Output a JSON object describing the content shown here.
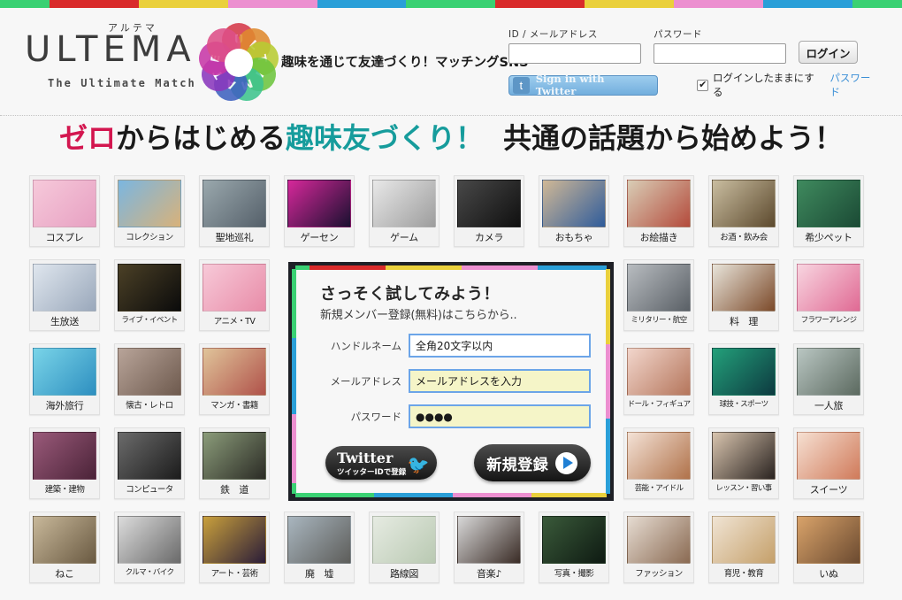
{
  "topbar_colors": [
    "#3ad173",
    "#d92b2b",
    "#ead03c",
    "#ec8fd0",
    "#2a9fd8"
  ],
  "header": {
    "logo_kana": "アルテマ",
    "logo_main": "ULTEMA",
    "logo_sub": "The Ultimate Match",
    "tagline": "趣味を通じて友達づくり！マッチングSNS",
    "flower_letters": [
      "U",
      "L",
      "T",
      "I",
      "M",
      "A",
      "T",
      "E"
    ],
    "flower_colors": [
      "#d6394a",
      "#e08a2f",
      "#b9cc33",
      "#6ec53f",
      "#3ec48e",
      "#3f62c0",
      "#8a38bd",
      "#c838a8",
      "#dd4f88"
    ]
  },
  "login": {
    "id_label": "ID / メールアドレス",
    "id_value": "",
    "id_placeholder": "",
    "password_label": "パスワード",
    "password_value": "",
    "password_placeholder": "",
    "login_button": "ログイン",
    "twitter_button": "Sign in with Twitter",
    "twitter_icon": "t",
    "keep_logged_in": "ログインしたままにする",
    "keep_checked": true,
    "password_link": "パスワード"
  },
  "headline": {
    "part1": "ゼロ",
    "part2": "からはじめる",
    "part3": "趣味友づくり！",
    "part4": "共通の話題から始めよう！",
    "color1": "#d3164f",
    "color3": "#169c9c"
  },
  "signup": {
    "title": "さっそく試してみよう！",
    "subtitle": "新規メンバー登録(無料)はこちらから..",
    "fields": [
      {
        "label": "ハンドルネーム",
        "value": "全角20文字以内",
        "style": "white"
      },
      {
        "label": "メールアドレス",
        "value": "メールアドレスを入力",
        "style": "yellow"
      },
      {
        "label": "パスワード",
        "value": "●●●●",
        "style": "yellow"
      }
    ],
    "twitter_main": "Twitter",
    "twitter_sub": "ツイッターIDで登録",
    "register_label": "新規登録",
    "border_top": [
      "#3ad173",
      "#d92b2b",
      "#ead03c",
      "#ec8fd0",
      "#2a9fd8"
    ],
    "border_bottom": [
      "#3ad173",
      "#2a9fd8",
      "#ec8fd0",
      "#ead03c"
    ],
    "border_left": [
      "#3ad173",
      "#2a9fd8",
      "#ec8fd0",
      "#3ad173"
    ],
    "border_right": [
      "#ead03c",
      "#ec8fd0",
      "#2a9fd8"
    ],
    "input_border": "#6ca5e8",
    "input_yellow_bg": "#f5f5c8"
  },
  "grid": {
    "rows": [
      [
        {
          "label": "コスプレ",
          "img": "cosplay",
          "c1": "#f6c9da",
          "c2": "#e7a0c2"
        },
        {
          "label": "コレクション",
          "img": "collection",
          "c1": "#7bb6e0",
          "c2": "#d8b27a",
          "size": "sq"
        },
        {
          "label": "聖地巡礼",
          "img": "pilgrimage",
          "c1": "#9aa8ad",
          "c2": "#55606a"
        },
        {
          "label": "ゲーセン",
          "img": "arcade",
          "c1": "#d6289a",
          "c2": "#1a1030"
        },
        {
          "label": "ゲーム",
          "img": "game",
          "c1": "#e8e8e8",
          "c2": "#9d9d9d"
        },
        {
          "label": "カメラ",
          "img": "camera",
          "c1": "#484848",
          "c2": "#101010"
        },
        {
          "label": "おもちゃ",
          "img": "toys",
          "c1": "#d0b896",
          "c2": "#2f5c9b"
        },
        {
          "label": "お絵描き",
          "img": "drawing",
          "c1": "#d9cdb6",
          "c2": "#b44b3c"
        },
        {
          "label": "お酒・飲み会",
          "img": "drinks",
          "c1": "#c9bda0",
          "c2": "#5d4a2e",
          "size": "sq"
        },
        {
          "label": "希少ペット",
          "img": "rare-pet",
          "c1": "#3f8a5e",
          "c2": "#1b4a35"
        }
      ],
      [
        {
          "label": "生放送",
          "img": "live-broadcast",
          "c1": "#dfe6ee",
          "c2": "#9aa8bb"
        },
        {
          "label": "ライブ・イベント",
          "img": "live-event",
          "c1": "#4b4026",
          "c2": "#0b0b0b",
          "size": "sq2"
        },
        {
          "label": "アニメ・TV",
          "img": "anime-tv",
          "c1": "#f7c9d8",
          "c2": "#e88ca8",
          "size": "sq"
        }
      ],
      [
        {
          "label": "海外旅行",
          "img": "overseas-travel",
          "c1": "#79d4e8",
          "c2": "#2e8fc0"
        },
        {
          "label": "懐古・レトロ",
          "img": "retro",
          "c1": "#b8a499",
          "c2": "#6e5a4e",
          "size": "sq"
        },
        {
          "label": "マンガ・書籍",
          "img": "manga-books",
          "c1": "#e0c49a",
          "c2": "#b0524a",
          "size": "sq"
        }
      ],
      [
        {
          "label": "建築・建物",
          "img": "architecture",
          "c1": "#9a5a7a",
          "c2": "#4b2338",
          "size": "sq"
        },
        {
          "label": "コンピュータ",
          "img": "computer",
          "c1": "#6b6b6b",
          "c2": "#1c1c1c",
          "size": "sq"
        },
        {
          "label": "鉄　道",
          "img": "railway",
          "c1": "#8b9c7a",
          "c2": "#2b2b25"
        }
      ],
      [
        {
          "label": "ねこ",
          "img": "cat",
          "c1": "#c8b89a",
          "c2": "#6a5a42"
        },
        {
          "label": "クルマ・バイク",
          "img": "car-bike",
          "c1": "#dcdcdc",
          "c2": "#6a6a6a",
          "size": "sq2"
        },
        {
          "label": "アート・芸術",
          "img": "art",
          "c1": "#c9a03c",
          "c2": "#2a1c38",
          "size": "sq"
        },
        {
          "label": "廃　墟",
          "img": "ruins",
          "c1": "#a9b6bf",
          "c2": "#5d5d5a"
        },
        {
          "label": "路線図",
          "img": "route-map",
          "c1": "#e6ebe2",
          "c2": "#b9c9b2"
        },
        {
          "label": "音楽♪",
          "img": "music",
          "c1": "#d8d8d8",
          "c2": "#3a2c26"
        },
        {
          "label": "写真・撮影",
          "img": "photography",
          "c1": "#3a5a3a",
          "c2": "#0e1a12",
          "size": "sq"
        },
        {
          "label": "ファッション",
          "img": "fashion",
          "c1": "#e6dcd2",
          "c2": "#8a6a52",
          "size": "sq"
        },
        {
          "label": "育児・教育",
          "img": "childcare",
          "c1": "#f0e4d4",
          "c2": "#c5a06a",
          "size": "sq"
        },
        {
          "label": "いぬ",
          "img": "dog",
          "c1": "#d9a36a",
          "c2": "#6b4a30"
        }
      ]
    ],
    "right_rows": [
      [
        {
          "label": "ミリタリー・航空",
          "img": "military-aviation",
          "c1": "#b8bcc0",
          "c2": "#5a6066",
          "size": "sq2"
        },
        {
          "label": "料　理",
          "img": "cooking",
          "c1": "#e8e4da",
          "c2": "#7c4a2a"
        },
        {
          "label": "フラワーアレンジ",
          "img": "flower-arrange",
          "c1": "#f8d5e0",
          "c2": "#e06a94",
          "size": "sq2"
        }
      ],
      [
        {
          "label": "ドール・フィギュア",
          "img": "doll-figure",
          "c1": "#f2d6cc",
          "c2": "#b5765c",
          "size": "sq2"
        },
        {
          "label": "球技・スポーツ",
          "img": "ball-sports",
          "c1": "#23a07a",
          "c2": "#0d3a40",
          "size": "sq2"
        },
        {
          "label": "一人旅",
          "img": "solo-travel",
          "c1": "#b9c6c2",
          "c2": "#5c6a60"
        }
      ],
      [
        {
          "label": "芸能・アイドル",
          "img": "entertainment-idol",
          "c1": "#f4e2d6",
          "c2": "#b0724a",
          "size": "sq2"
        },
        {
          "label": "レッスン・習い事",
          "img": "lessons",
          "c1": "#d8c4ae",
          "c2": "#2a2320",
          "size": "sq2"
        },
        {
          "label": "スイーツ",
          "img": "sweets",
          "c1": "#f6e0d2",
          "c2": "#d07a5a"
        }
      ]
    ]
  }
}
